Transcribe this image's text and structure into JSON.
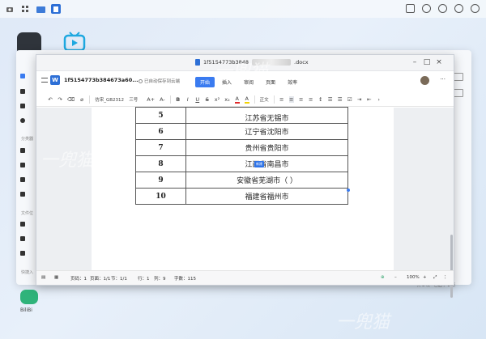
{
  "bg_window": {
    "sidebar_labels": [
      "分类器",
      "文件位",
      "快捷入"
    ],
    "right_label": "共 8 项 · 已选中 1 项",
    "dock_label": "BiliBi"
  },
  "doc": {
    "title_prefix": "1f5154773b3848",
    "title_suffix": ".docx",
    "doc_name": "1f5154773b384673a60...",
    "autosave": "已自动保存到云端",
    "tabs": [
      "开始",
      "插入",
      "审阅",
      "页面",
      "效率"
    ],
    "toolbar": {
      "font": "仿宋_GB2312",
      "size": "三号",
      "grow": "A+",
      "shrink": "A-",
      "bold": "B",
      "italic": "I",
      "underline": "U",
      "strike": "S",
      "superscript": "x²",
      "subscript": "x₂",
      "font_color": "A",
      "highlight": "A",
      "styles": "正文"
    },
    "table": {
      "rows": [
        {
          "num": "5",
          "city": "江苏省无锡市"
        },
        {
          "num": "6",
          "city": "辽宁省沈阳市"
        },
        {
          "num": "7",
          "city": "贵州省贵阳市"
        },
        {
          "num": "8",
          "city": "江西省南昌市"
        },
        {
          "num": "9",
          "city": "安徽省芜湖市（ ）"
        },
        {
          "num": "10",
          "city": "福建省福州市"
        }
      ],
      "badge": "新建"
    },
    "status": {
      "words": "页码：1",
      "page": "页面：1/1",
      "section": "节：1/1",
      "row": "行：1",
      "col": "列：9",
      "count": "字数：115",
      "zoom": "100%"
    }
  },
  "watermark": "一兜猫"
}
